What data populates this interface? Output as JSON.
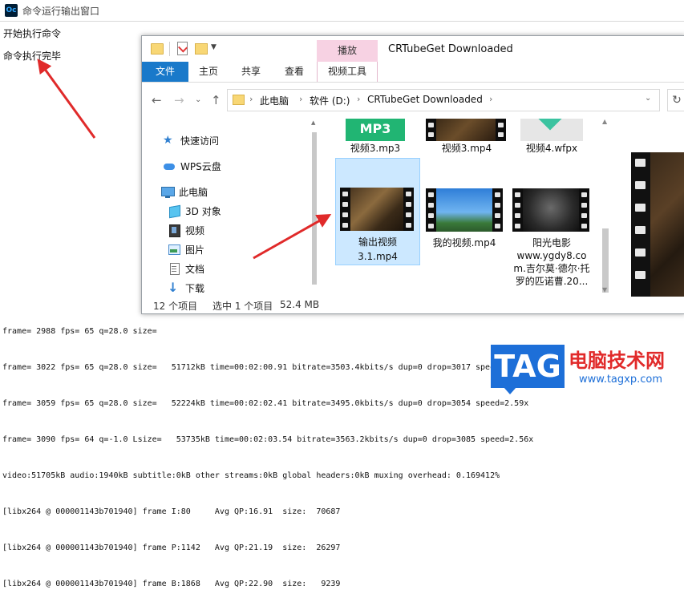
{
  "console": {
    "app_icon_text": "Oc",
    "title": "命令运行输出窗口",
    "lines": [
      "开始执行命令",
      "命令执行完毕"
    ],
    "log": [
      "frame= 2988 fps= 65 q=28.0 size=",
      "frame= 3022 fps= 65 q=28.0 size=   51712kB time=00:02:00.91 bitrate=3503.4kbits/s dup=0 drop=3017 speed=2.59x",
      "frame= 3059 fps= 65 q=28.0 size=   52224kB time=00:02:02.41 bitrate=3495.0kbits/s dup=0 drop=3054 speed=2.59x",
      "frame= 3090 fps= 64 q=-1.0 Lsize=   53735kB time=00:02:03.54 bitrate=3563.2kbits/s dup=0 drop=3085 speed=2.56x",
      "video:51705kB audio:1940kB subtitle:0kB other streams:0kB global headers:0kB muxing overhead: 0.169412%",
      "[libx264 @ 000001143b701940] frame I:80     Avg QP:16.91  size:  70687",
      "[libx264 @ 000001143b701940] frame P:1142   Avg QP:21.19  size:  26297",
      "[libx264 @ 000001143b701940] frame B:1868   Avg QP:22.90  size:   9239"
    ]
  },
  "explorer": {
    "title": "CRTubeGet Downloaded",
    "contextual_tab": "播放",
    "ribbon_tabs": [
      "文件",
      "主页",
      "共享",
      "查看",
      "视频工具"
    ],
    "breadcrumb": [
      "此电脑",
      "软件 (D:)",
      "CRTubeGet Downloaded"
    ],
    "nav_items": [
      "快速访问",
      "WPS云盘",
      "此电脑",
      "3D 对象",
      "视频",
      "图片",
      "文档",
      "下载"
    ],
    "files": [
      {
        "name": "视频3.mp3",
        "badge": "MP3"
      },
      {
        "name": "视频3.mp4"
      },
      {
        "name": "视频4.wfpx"
      },
      {
        "name_lines": [
          "输出视频",
          "3.1.mp4"
        ],
        "selected": true
      },
      {
        "name": "我的视频.mp4"
      },
      {
        "name_lines": [
          "阳光电影",
          "www.ygdy8.co",
          "m.吉尔莫·德尔·托",
          "罗的匹诺曹.20..."
        ]
      }
    ],
    "status": {
      "count": "12 个项目",
      "selection": "选中 1 个项目",
      "size": "52.4 MB"
    }
  },
  "watermark": {
    "tag": "TAG",
    "name": "电脑技术网",
    "url": "www.tagxp.com"
  },
  "colors": {
    "ribbon_file": "#1979ca",
    "contextual": "#f7d2e3",
    "selection": "#cce8ff",
    "arrow": "#e02a2a",
    "mp3": "#21b573"
  }
}
